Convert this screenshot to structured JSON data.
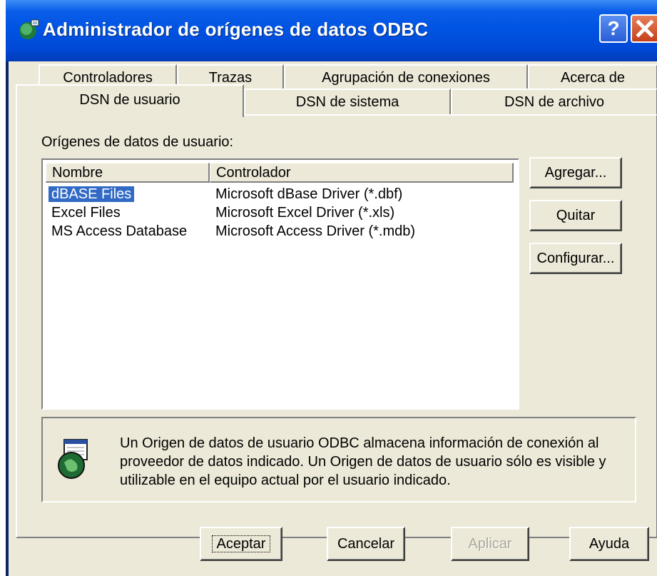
{
  "window": {
    "title": "Administrador de orígenes de datos ODBC"
  },
  "title_buttons": {
    "help": "?",
    "close": "close"
  },
  "tabs_row1": [
    "Controladores",
    "Trazas",
    "Agrupación de conexiones",
    "Acerca de"
  ],
  "tabs_row2": [
    "DSN de usuario",
    "DSN de sistema",
    "DSN de archivo"
  ],
  "active_tab": "DSN de usuario",
  "panel": {
    "group_label": "Orígenes de datos de usuario:"
  },
  "list": {
    "columns": [
      "Nombre",
      "Controlador"
    ],
    "rows": [
      {
        "name": "dBASE Files",
        "driver": "Microsoft dBase Driver (*.dbf)",
        "selected": true
      },
      {
        "name": "Excel Files",
        "driver": "Microsoft Excel Driver (*.xls)",
        "selected": false
      },
      {
        "name": "MS Access Database",
        "driver": "Microsoft Access Driver (*.mdb)",
        "selected": false
      }
    ]
  },
  "buttons": {
    "add": "Agregar...",
    "remove": "Quitar",
    "configure": "Configurar..."
  },
  "info": {
    "text": "Un Origen de datos de usuario ODBC almacena información de conexión al proveedor de datos indicado. Un Origen de datos de usuario sólo es visible y utilizable en el equipo actual por el usuario indicado.",
    "icon": "odbc-database-icon"
  },
  "footer": {
    "ok": "Aceptar",
    "cancel": "Cancelar",
    "apply": "Aplicar",
    "help": "Ayuda"
  },
  "colors": {
    "title_bar": "#0054e3",
    "dialog_bg": "#ece9d8",
    "selection": "#316ac5",
    "close_button": "#c4401a"
  }
}
